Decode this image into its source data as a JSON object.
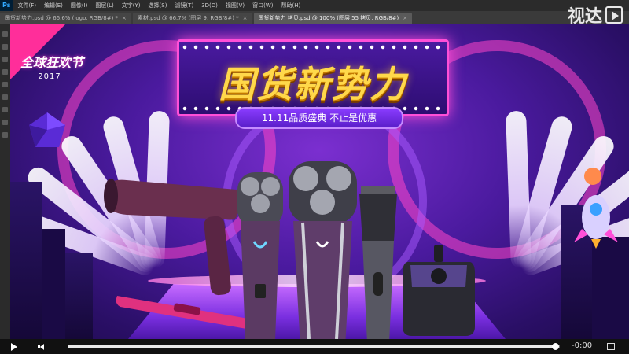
{
  "app": {
    "logo": "Ps",
    "menu": [
      "文件(F)",
      "编辑(E)",
      "图像(I)",
      "图层(L)",
      "文字(Y)",
      "选择(S)",
      "滤镜(T)",
      "3D(D)",
      "视图(V)",
      "窗口(W)",
      "帮助(H)"
    ]
  },
  "tabs": [
    {
      "label": "国货新势力.psd @ 66.6% (logo, RGB/8#) *",
      "close": "×"
    },
    {
      "label": "素材.psd @ 66.7% (图层 9, RGB/8#) *",
      "close": "×"
    },
    {
      "label": "国货新势力 拷贝.psd @ 100% (图层 55 拷贝, RGB/8#)",
      "close": "×"
    }
  ],
  "active_tab_index": 2,
  "watermark": {
    "text": "视达",
    "icon": "play-square-icon"
  },
  "canvas": {
    "badge_title": "全球狂欢节",
    "badge_year": "2017",
    "headline": "国货新势力",
    "subtitle": "11.11品质盛典  不止是优惠",
    "colors": {
      "accent_pink": "#ff4fd8",
      "headline_gold": "#ffd84a",
      "bg_purple": "#4a1a9e"
    },
    "products": [
      "hair-dryer-icon",
      "shaver-icon",
      "shaver-large-icon",
      "hair-clipper-icon",
      "steamer-icon",
      "hair-straightener-icon"
    ]
  },
  "player": {
    "progress": 0.99,
    "time": "-0:00",
    "icons": [
      "play-icon",
      "volume-icon",
      "fullscreen-icon"
    ]
  }
}
